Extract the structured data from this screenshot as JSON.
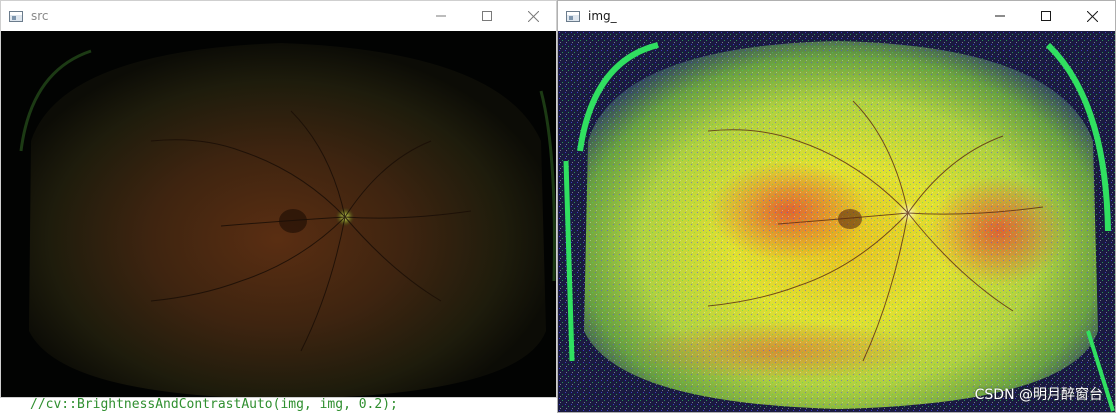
{
  "editor": {
    "code_line": "//cv::BrightnessAndContrastAuto(img, img, 0.2);"
  },
  "windows": [
    {
      "title": "src",
      "image": "fundus-retina-dark",
      "icons": {
        "app": "opencv-window-icon",
        "minimize": "minimize-icon",
        "maximize": "maximize-icon",
        "close": "close-icon"
      }
    },
    {
      "title": "img_",
      "image": "fundus-retina-enhanced",
      "icons": {
        "app": "opencv-window-icon",
        "minimize": "minimize-icon",
        "maximize": "maximize-icon",
        "close": "close-icon"
      }
    }
  ],
  "watermark": "CSDN @明月醉窗台",
  "colors": {
    "src_retina_center": "#4a2a10",
    "src_retina_edge": "#1a1a0a",
    "enh_yellow": "#e8e020",
    "enh_orange": "#e07020",
    "enh_green": "#30e060",
    "enh_blue": "#4040ff"
  }
}
